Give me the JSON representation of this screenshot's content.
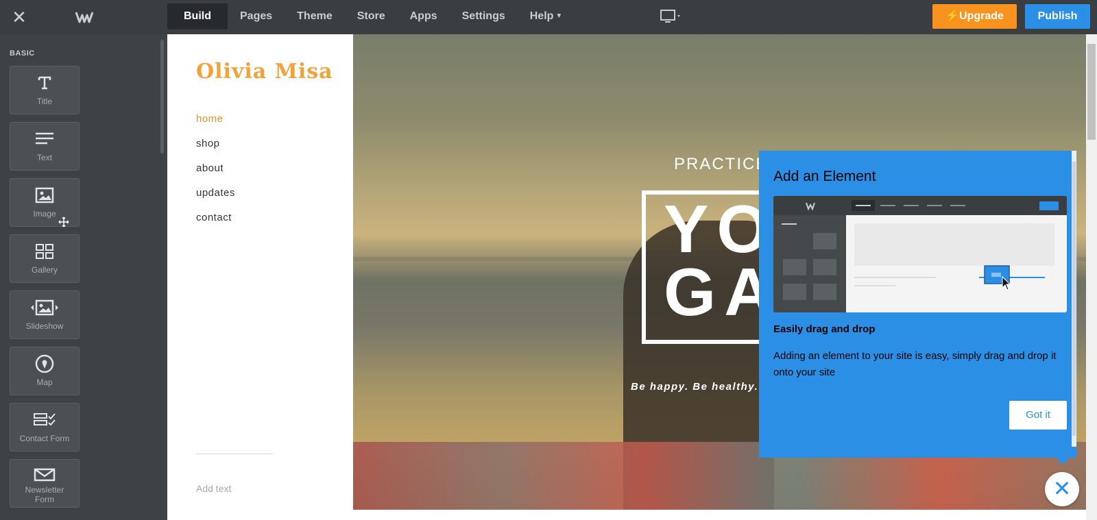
{
  "topbar": {
    "close_icon": "close-icon",
    "logo_icon": "weebly-logo",
    "tabs": [
      {
        "label": "Build",
        "active": true
      },
      {
        "label": "Pages"
      },
      {
        "label": "Theme"
      },
      {
        "label": "Store"
      },
      {
        "label": "Apps"
      },
      {
        "label": "Settings"
      },
      {
        "label": "Help",
        "dropdown": true
      }
    ],
    "device_icon": "desktop-monitor-icon",
    "upgrade_label": "Upgrade",
    "publish_label": "Publish",
    "colors": {
      "upgrade": "#f7931e",
      "publish": "#2b8fe5",
      "bar": "#3a3e41"
    }
  },
  "sidebar": {
    "section_label": "BASIC",
    "elements": [
      {
        "label": "Title",
        "icon": "title-icon"
      },
      {
        "label": "Text",
        "icon": "text-lines-icon"
      },
      {
        "label": "Image",
        "icon": "image-icon"
      },
      {
        "label": "Gallery",
        "icon": "gallery-grid-icon"
      },
      {
        "label": "Slideshow",
        "icon": "slideshow-icon"
      },
      {
        "label": "Map",
        "icon": "map-pin-icon"
      },
      {
        "label": "Contact Form",
        "icon": "contact-form-icon"
      },
      {
        "label": "Newsletter Form",
        "icon": "newsletter-envelope-icon"
      }
    ]
  },
  "site": {
    "title": "Olivia Misa",
    "nav": [
      "home",
      "shop",
      "about",
      "updates",
      "contact"
    ],
    "active_nav": "home",
    "add_text_placeholder": "Add text",
    "accent": "#f1a23a"
  },
  "hero": {
    "kicker": "PRACTICE",
    "big_line1": "YO",
    "big_line2": "GA",
    "tagline": "Be happy. Be healthy."
  },
  "popover": {
    "title": "Add an Element",
    "subtitle": "Easily drag and drop",
    "body": "Adding an element to your site is easy, simply drag and drop it onto your site",
    "button_label": "Got it",
    "color": "#2b8fe5"
  }
}
